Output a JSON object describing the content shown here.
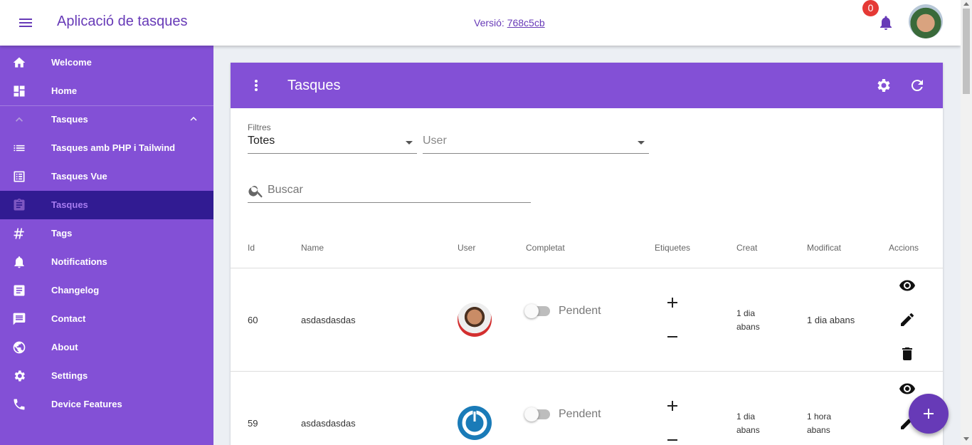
{
  "app": {
    "title": "Aplicació de tasques",
    "version_label": "Versió:",
    "version_hash": "768c5cb",
    "notification_count": "0",
    "menu_icon": "menu-icon",
    "bell_icon": "bell-icon",
    "accent_color": "#673ab7",
    "sidebar_color": "#8350d6",
    "active_item_color": "#311b92"
  },
  "sidebar": {
    "items": [
      {
        "label": "Welcome",
        "icon": "home-icon"
      },
      {
        "label": "Home",
        "icon": "dashboard-icon"
      },
      {
        "label": "Tasques",
        "icon": "chevron-up-icon",
        "expanded": true
      },
      {
        "label": "Tasques amb PHP i Tailwind",
        "icon": "list-icon"
      },
      {
        "label": "Tasques Vue",
        "icon": "list-alt-icon"
      },
      {
        "label": "Tasques",
        "icon": "assignment-icon",
        "active": true
      },
      {
        "label": "Tags",
        "icon": "hashtag-icon"
      },
      {
        "label": "Notifications",
        "icon": "bell-icon"
      },
      {
        "label": "Changelog",
        "icon": "notes-icon"
      },
      {
        "label": "Contact",
        "icon": "message-icon"
      },
      {
        "label": "About",
        "icon": "globe-icon"
      },
      {
        "label": "Settings",
        "icon": "gear-icon"
      },
      {
        "label": "Device Features",
        "icon": "phone-icon"
      }
    ]
  },
  "card": {
    "title": "Tasques",
    "filters": {
      "label": "Filtres",
      "selected": "Totes",
      "user_placeholder": "User"
    },
    "search": {
      "placeholder": "Buscar"
    },
    "columns": [
      "Id",
      "Name",
      "User",
      "Completat",
      "Etiquetes",
      "Creat",
      "Modificat",
      "Accions"
    ],
    "rows": [
      {
        "id": "60",
        "name": "asdasdasdas",
        "status": "Pendent",
        "created_l1": "1 dia",
        "created_l2": "abans",
        "modified_l1": "1 dia abans",
        "modified_l2": ""
      },
      {
        "id": "59",
        "name": "asdasdasdas",
        "status": "Pendent",
        "created_l1": "1 dia",
        "created_l2": "abans",
        "modified_l1": "1 hora",
        "modified_l2": "abans"
      }
    ]
  }
}
